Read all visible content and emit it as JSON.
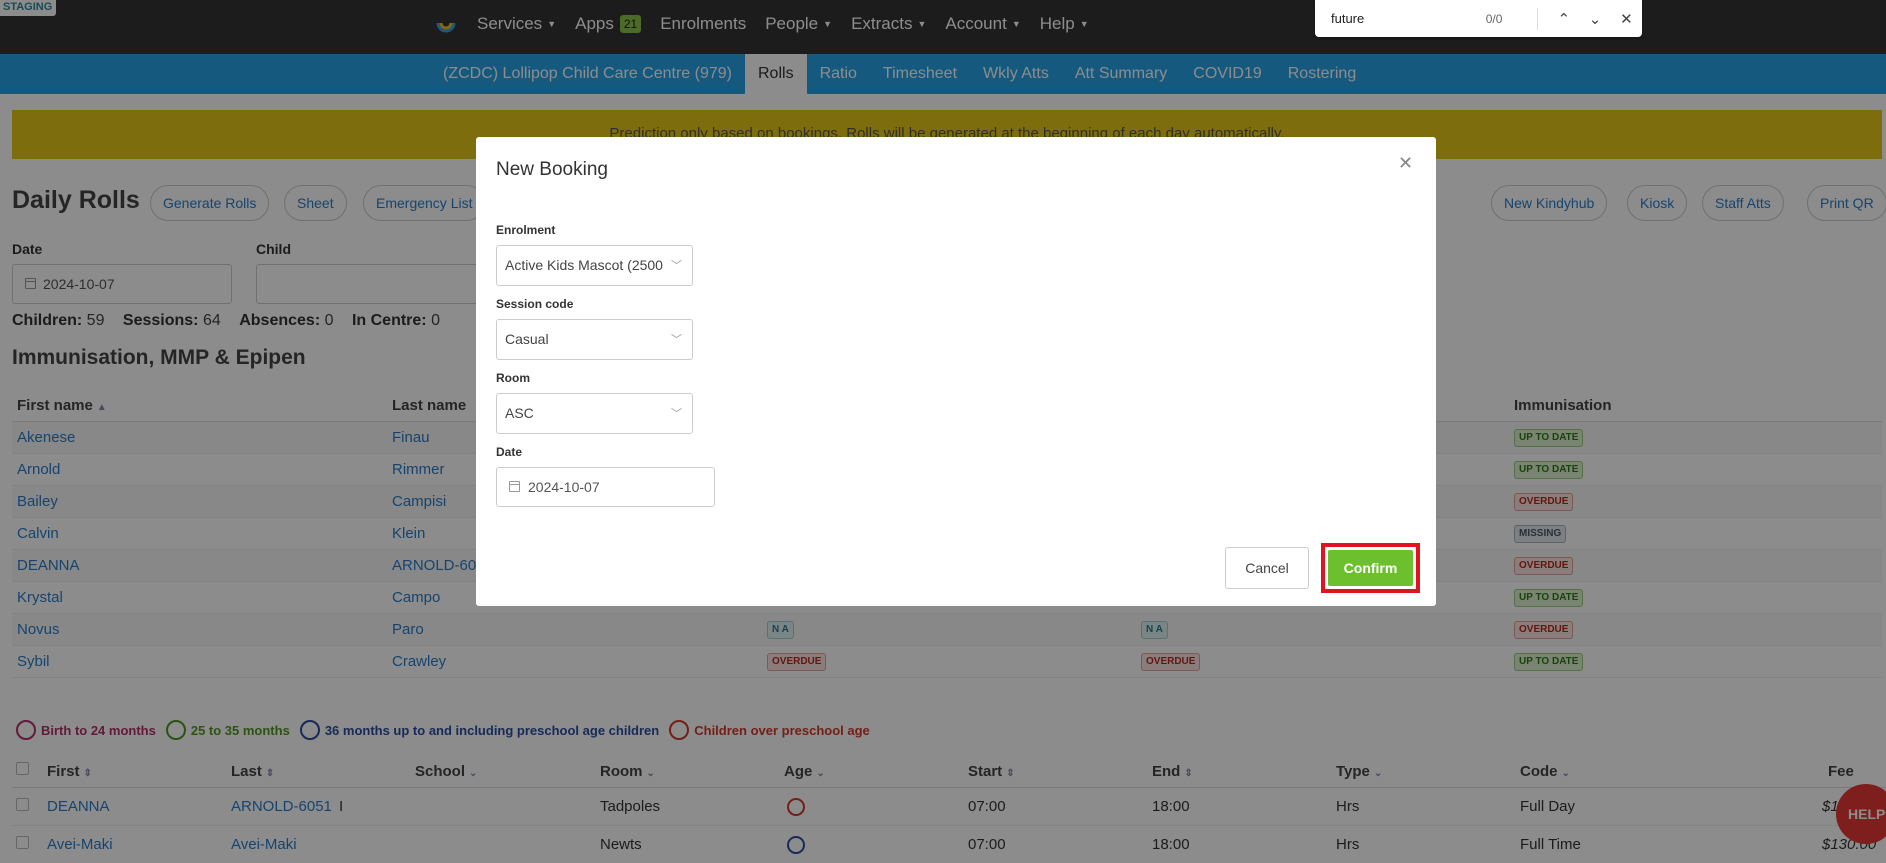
{
  "env": {
    "staging_label": "STAGING"
  },
  "topnav": {
    "items": [
      {
        "label": "Services",
        "caret": true
      },
      {
        "label": "Apps",
        "badge": "21"
      },
      {
        "label": "Enrolments"
      },
      {
        "label": "People",
        "caret": true
      },
      {
        "label": "Extracts",
        "caret": true
      },
      {
        "label": "Account",
        "caret": true
      },
      {
        "label": "Help",
        "caret": true
      }
    ]
  },
  "findbar": {
    "query": "future",
    "count": "0/0"
  },
  "subnav": {
    "centre": "(ZCDC) Lollipop Child Care Centre (979)",
    "tabs": [
      "Rolls",
      "Ratio",
      "Timesheet",
      "Wkly Atts",
      "Att Summary",
      "COVID19",
      "Rostering"
    ],
    "active": "Rolls"
  },
  "banner": {
    "text": "Prediction only based on bookings. Rolls will be generated at the beginning of each day automatically."
  },
  "page": {
    "title": "Daily Rolls",
    "left_buttons": [
      "Generate Rolls",
      "Sheet",
      "Emergency List"
    ],
    "right_buttons": [
      "New Kindyhub",
      "Kiosk",
      "Staff Atts",
      "Print QR"
    ],
    "date_label": "Date",
    "date_value": "2024-10-07",
    "child_label": "Child"
  },
  "counts": {
    "children_label": "Children:",
    "children": "59",
    "sessions_label": "Sessions:",
    "sessions": "64",
    "absences_label": "Absences:",
    "absences": "0",
    "incentre_label": "In Centre:",
    "incentre": "0"
  },
  "immunisation": {
    "title": "Immunisation, MMP & Epipen",
    "headers": {
      "first": "First name",
      "last": "Last name",
      "immunisation": "Immunisation"
    },
    "rows": [
      {
        "first": "Akenese",
        "last": "Finau",
        "c3": "",
        "c4": "",
        "imm": "UP TO DATE",
        "imm_color": "green"
      },
      {
        "first": "Arnold",
        "last": "Rimmer",
        "c3": "",
        "c4": "",
        "imm": "UP TO DATE",
        "imm_color": "green"
      },
      {
        "first": "Bailey",
        "last": "Campisi",
        "c3": "",
        "c4": "",
        "imm": "OVERDUE",
        "imm_color": "red"
      },
      {
        "first": "Calvin",
        "last": "Klein",
        "c3": "",
        "c4": "",
        "imm": "MISSING",
        "imm_color": "grey"
      },
      {
        "first": "DEANNA",
        "last": "ARNOLD-6051",
        "c3": "",
        "c4": "",
        "imm": "OVERDUE",
        "imm_color": "red"
      },
      {
        "first": "Krystal",
        "last": "Campo",
        "c3": "",
        "c4": "",
        "imm": "UP TO DATE",
        "imm_color": "green"
      },
      {
        "first": "Novus",
        "last": "Paro",
        "c3": "N A",
        "c4": "N A",
        "imm": "OVERDUE",
        "imm_color": "red"
      },
      {
        "first": "Sybil",
        "last": "Crawley",
        "c3": "OVERDUE",
        "c4": "OVERDUE",
        "imm": "UP TO DATE",
        "imm_color": "green"
      }
    ]
  },
  "age_legend": [
    {
      "label": "Birth to 24 months",
      "color": "#b5306a"
    },
    {
      "label": "25 to 35 months",
      "color": "#4f9a1f"
    },
    {
      "label": "36 months up to and including preschool age children",
      "color": "#2b4ea0"
    },
    {
      "label": "Children over preschool age",
      "color": "#d23a2a"
    }
  ],
  "bookings": {
    "headers": [
      "First",
      "Last",
      "School",
      "Room",
      "Age",
      "Start",
      "End",
      "Type",
      "Code",
      "Fee"
    ],
    "rows": [
      {
        "first": "DEANNA",
        "last": "ARNOLD-6051",
        "school": "I",
        "room": "Tadpoles",
        "start": "07:00",
        "end": "18:00",
        "type": "Hrs",
        "code": "Full Day",
        "fee": "$1"
      },
      {
        "first": "Avei-Maki",
        "last": "Avei-Maki",
        "school": "",
        "room": "Newts",
        "start": "07:00",
        "end": "18:00",
        "type": "Hrs",
        "code": "Full Time",
        "fee": "$130.00"
      }
    ]
  },
  "help": {
    "label": "HELP"
  },
  "modal": {
    "title": "New Booking",
    "enrolment_label": "Enrolment",
    "enrolment_value": "Active Kids Mascot (2500",
    "session_label": "Session code",
    "session_value": "Casual",
    "room_label": "Room",
    "room_value": "ASC",
    "date_label": "Date",
    "date_value": "2024-10-07",
    "cancel": "Cancel",
    "confirm": "Confirm"
  }
}
